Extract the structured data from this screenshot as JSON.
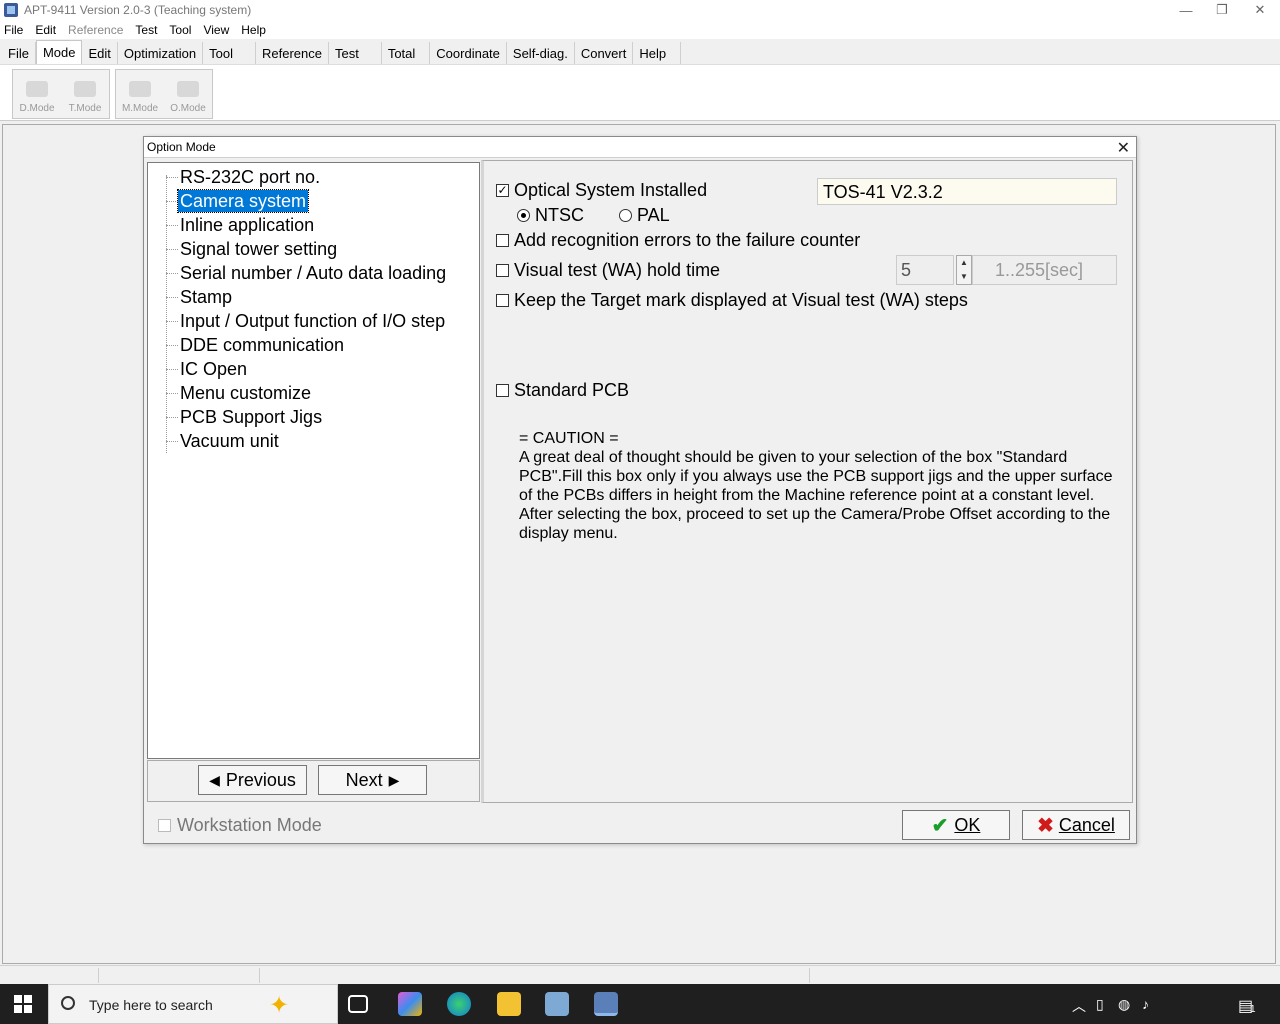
{
  "window": {
    "title": "APT-9411 Version 2.0-3 (Teaching system)",
    "minimize": "—",
    "restore": "❐",
    "close": "✕"
  },
  "menubar": [
    "File",
    "Edit",
    "Reference",
    "Test",
    "Tool",
    "View",
    "Help"
  ],
  "tabs": [
    "File",
    "Mode",
    "Edit",
    "Optimization",
    "Tool",
    "Reference",
    "Test",
    "Total",
    "Coordinate",
    "Self-diag.",
    "Convert",
    "Help"
  ],
  "active_tab": "Mode",
  "toolbar": {
    "dmode": "D.Mode",
    "tmode": "T.Mode",
    "mmode": "M.Mode",
    "omode": "O.Mode"
  },
  "dialog": {
    "title": "Option Mode",
    "close": "✕",
    "tree": [
      "RS-232C port no.",
      "Camera system",
      "Inline application",
      "Signal tower setting",
      "Serial number / Auto data loading",
      "Stamp",
      "Input / Output function of I/O step",
      "DDE communication",
      "IC Open",
      "Menu customize",
      "PCB Support Jigs",
      "Vacuum unit"
    ],
    "selected_item": "Camera system",
    "previous": "Previous",
    "next": "Next",
    "optical_installed": "Optical System Installed",
    "optical_version": "TOS-41 V2.3.2",
    "ntsc": "NTSC",
    "pal": "PAL",
    "add_recognition": "Add recognition errors to the failure counter",
    "visual_hold": "Visual test (WA) hold time",
    "hold_value": "5",
    "hold_range": "1..255[sec]",
    "keep_target": "Keep the Target mark displayed at Visual test (WA) steps",
    "standard_pcb": "Standard PCB",
    "caution_title": "= CAUTION =",
    "caution_text": "A great deal of thought should be given to your selection of the box \"Standard PCB\".Fill this box only if you always use the PCB support jigs and the upper surface of the PCBs differs in height from the Machine reference point at a constant level. After selecting the box, proceed to set up the Camera/Probe Offset according to the display menu.",
    "workstation": "Workstation Mode",
    "ok": "OK",
    "cancel": "Cancel"
  },
  "taskbar": {
    "search_placeholder": "Type here to search",
    "notification_count": "1"
  },
  "colors": {
    "selection": "#0078d7",
    "ok_check": "#1a9e2a",
    "cancel_x": "#d11a1a",
    "taskbar": "#1f1f1f"
  }
}
